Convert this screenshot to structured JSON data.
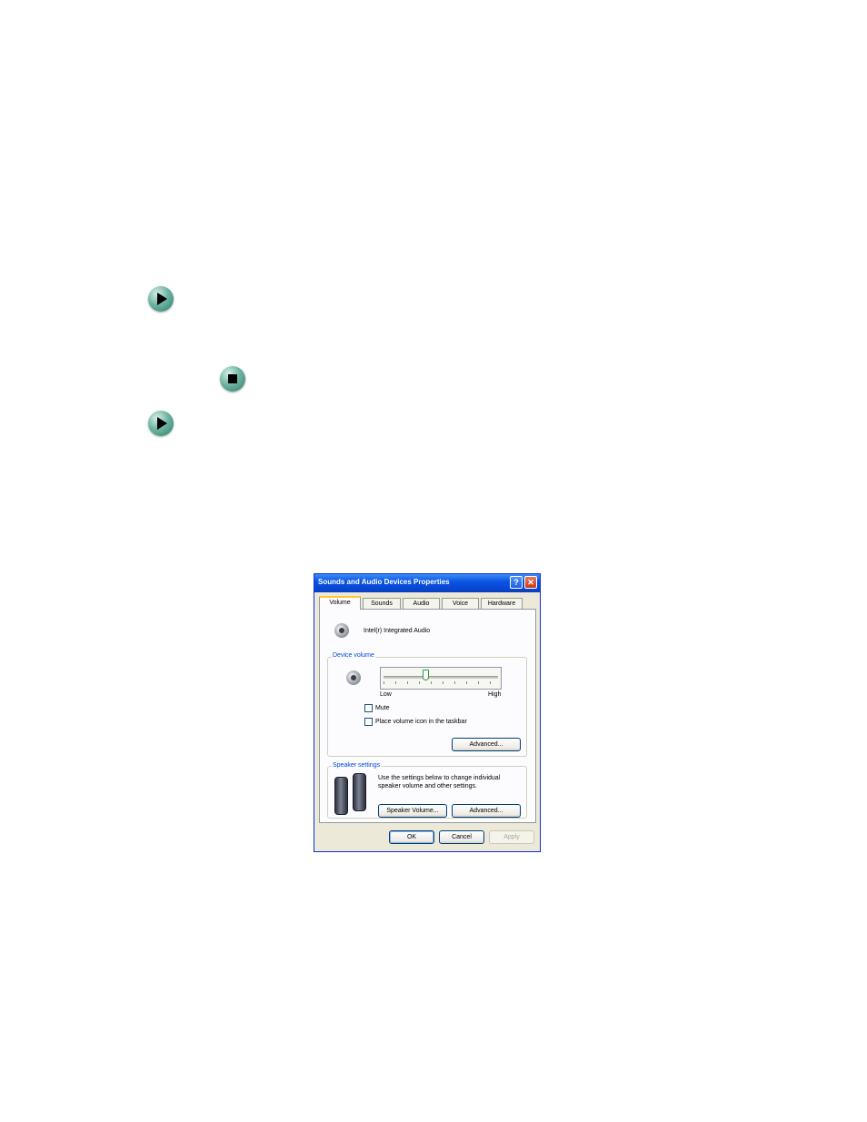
{
  "dialog": {
    "title": "Sounds and Audio Devices Properties",
    "help_glyph": "?",
    "close_glyph": "✕",
    "tabs": [
      {
        "label": "Volume",
        "active": true
      },
      {
        "label": "Sounds",
        "active": false
      },
      {
        "label": "Audio",
        "active": false
      },
      {
        "label": "Voice",
        "active": false
      },
      {
        "label": "Hardware",
        "active": false
      }
    ],
    "device_name": "Intel(r) Integrated Audio",
    "device_volume": {
      "group_label": "Device volume",
      "low_label": "Low",
      "high_label": "High",
      "level_fraction": 0.36,
      "mute_label": "Mute",
      "mute_checked": false,
      "taskbar_label": "Place volume icon in the taskbar",
      "taskbar_checked": false,
      "advanced_label": "Advanced..."
    },
    "speaker_settings": {
      "group_label": "Speaker settings",
      "description_line1": "Use the settings below to change individual",
      "description_line2": "speaker volume and other settings.",
      "speaker_volume_label": "Speaker Volume...",
      "advanced_label": "Advanced..."
    },
    "footer": {
      "ok_label": "OK",
      "cancel_label": "Cancel",
      "apply_label": "Apply"
    }
  },
  "icons": {
    "bullet_1": "play-arrow-icon",
    "bullet_2": "stop-square-icon",
    "bullet_3": "play-arrow-icon"
  }
}
